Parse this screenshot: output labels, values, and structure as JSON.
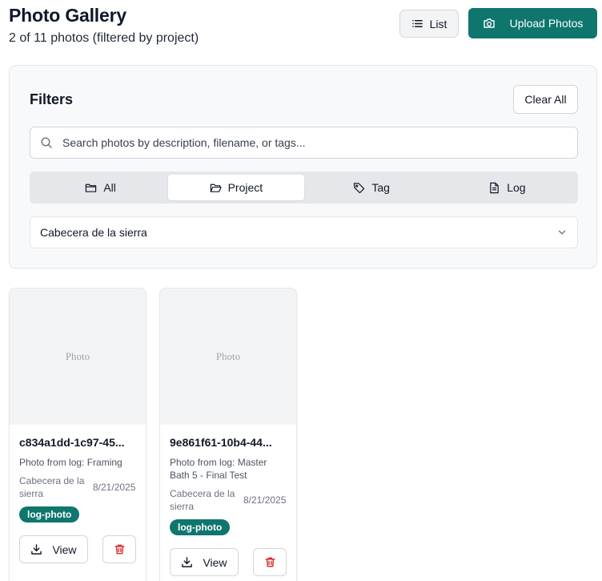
{
  "header": {
    "title": "Photo Gallery",
    "subtitle": "2 of 11 photos (filtered by project)",
    "list_button": "List",
    "upload_button": "Upload Photos"
  },
  "filters": {
    "title": "Filters",
    "clear_button": "Clear All",
    "search_placeholder": "Search photos by description, filename, or tags...",
    "tabs": [
      {
        "label": "All",
        "icon": "folder-icon"
      },
      {
        "label": "Project",
        "icon": "folder-open-icon",
        "active": true
      },
      {
        "label": "Tag",
        "icon": "tag-icon"
      },
      {
        "label": "Log",
        "icon": "file-text-icon"
      }
    ],
    "selected_project": "Cabecera de la sierra"
  },
  "photos": [
    {
      "placeholder": "Photo",
      "filename": "c834a1dd-1c97-45...",
      "description": "Photo from log: Framing",
      "project": "Cabecera de la sierra",
      "date": "8/21/2025",
      "tag": "log-photo",
      "view_label": "View"
    },
    {
      "placeholder": "Photo",
      "filename": "9e861f61-10b4-44...",
      "description": "Photo from log: Master Bath 5 - Final Test",
      "project": "Cabecera de la sierra",
      "date": "8/21/2025",
      "tag": "log-photo",
      "view_label": "View"
    }
  ],
  "colors": {
    "accent": "#0f766e",
    "delete": "#dc2626"
  }
}
